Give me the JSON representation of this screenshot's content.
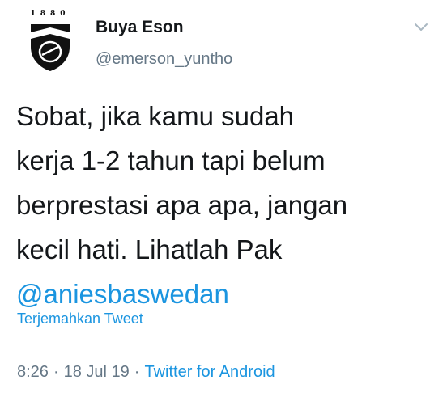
{
  "author": {
    "avatar_text": "1880",
    "display_name": "Buya Eson",
    "handle": "@emerson_yuntho"
  },
  "tweet": {
    "lines": [
      "Sobat, jika kamu sudah",
      "kerja 1-2 tahun tapi belum",
      "berprestasi apa apa, jangan",
      "kecil hati. Lihatlah Pak"
    ],
    "mention": "@aniesbaswedan",
    "translate_label": "Terjemahkan Tweet"
  },
  "meta": {
    "time": "8:26",
    "separator": "·",
    "date": "18 Jul 19",
    "source": "Twitter for Android"
  },
  "icons": {
    "menu": "chevron-down-icon",
    "avatar": "crest-logo"
  },
  "colors": {
    "text": "#14171a",
    "secondary": "#657786",
    "link": "#1b95e0"
  }
}
